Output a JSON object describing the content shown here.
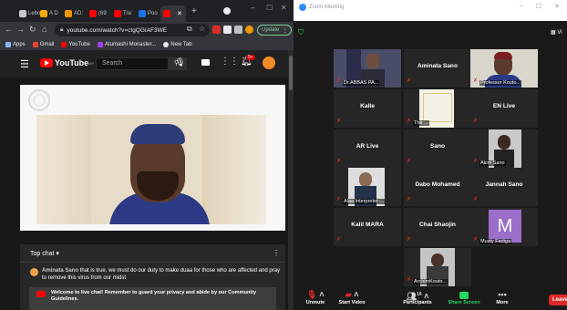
{
  "browser": {
    "tabs": [
      {
        "label": "Lebo",
        "color": "#c9c9c9"
      },
      {
        "label": "A D",
        "color": "#f9ab00"
      },
      {
        "label": "AD:",
        "color": "#f29900"
      },
      {
        "label": "(69",
        "color": "#ff0000"
      },
      {
        "label": "Tre:",
        "color": "#ff0000"
      },
      {
        "label": "Poo",
        "color": "#1a73e8"
      },
      {
        "label": "",
        "color": "#ff0000"
      }
    ],
    "new_tab_glyph": "+",
    "url": "youtube.com/watch?v=ctgQGIAF3WE",
    "update_label": "Update",
    "bookmarks": [
      {
        "label": "Apps",
        "icon": "apps-grid-icon",
        "color": "#8ab4f8"
      },
      {
        "label": "Gmail",
        "icon": "gmail-icon",
        "color": "#ea4335"
      },
      {
        "label": "YouTube",
        "icon": "youtube-icon",
        "color": "#ff0000"
      },
      {
        "label": "Atumashi Monaster...",
        "icon": "page-icon",
        "color": "#a142f4"
      },
      {
        "label": "New Tab",
        "icon": "globe-icon",
        "color": "#e8eaed"
      }
    ]
  },
  "youtube": {
    "logo_text": "YouTube",
    "logo_suffix": "MY",
    "search_placeholder": "Search",
    "notification_count": "9+",
    "chat": {
      "header": "Top chat",
      "message_author": "Aminata Sano",
      "message_text": "that is true, we must do our duty to make duaa for those who are affected and pray to remove this virus from our midst",
      "notice_text": "Welcome to live chat! Remember to guard your privacy and abide by our Community Guidelines."
    }
  },
  "zoom": {
    "window_title": "Zoom Meeting",
    "view_label": "Vi",
    "participants": [
      {
        "name": "",
        "caption": "Dr.ABBAS PA...",
        "video": true,
        "active": false
      },
      {
        "name": "Aminata Sano",
        "caption": "",
        "video": false,
        "active": false
      },
      {
        "name": "",
        "caption": "Professor Kouto...",
        "video": true,
        "active": true
      },
      {
        "name": "Kalle",
        "caption": "",
        "video": false,
        "active": false
      },
      {
        "name": "",
        "caption": "The ...",
        "video": true,
        "active": false
      },
      {
        "name": "EN Live",
        "caption": "",
        "video": false,
        "active": false
      },
      {
        "name": "AR Live",
        "caption": "",
        "video": false,
        "active": false
      },
      {
        "name": "Sano",
        "caption": "",
        "video": false,
        "active": false
      },
      {
        "name": "",
        "caption": "Akim Sano",
        "video": true,
        "active": false
      },
      {
        "name": "",
        "caption": "Alaa Interpreter ...",
        "video": true,
        "active": false
      },
      {
        "name": "Dabo Mohamed",
        "caption": "",
        "video": false,
        "active": false
      },
      {
        "name": "Jannah Sano",
        "caption": "",
        "video": false,
        "active": false
      },
      {
        "name": "Kalil MARA",
        "caption": "",
        "video": false,
        "active": false
      },
      {
        "name": "Chai Shaojin",
        "caption": "",
        "video": false,
        "active": false
      },
      {
        "name": "",
        "caption": "Musty Fadiga",
        "video": false,
        "avatar": "M",
        "active": false
      },
      {
        "name": "",
        "caption": "ArchimKouto...",
        "video": true,
        "active": false
      }
    ],
    "toolbar": {
      "unmute": "Unmute",
      "start_video": "Start Video",
      "participants": "Participants",
      "participant_count": "16",
      "share_screen": "Share Screen",
      "more": "More",
      "leave": "Leave"
    }
  }
}
